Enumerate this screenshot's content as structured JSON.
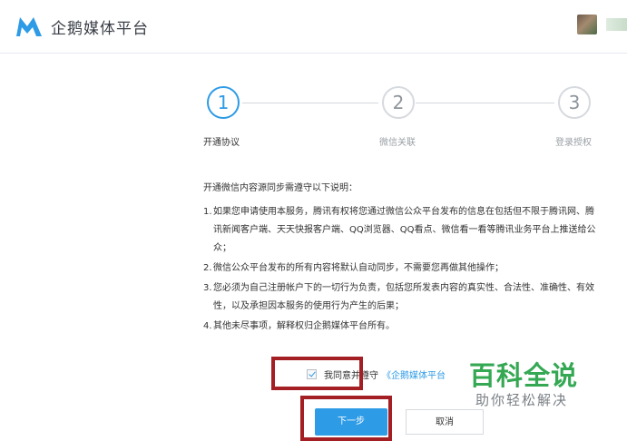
{
  "header": {
    "brand": "企鹅媒体平台",
    "logo_icon": "penguin-media-logo-icon",
    "avatar_icon": "user-avatar-icon"
  },
  "steps": [
    {
      "number": "1",
      "label": "开通协议",
      "active": true
    },
    {
      "number": "2",
      "label": "微信关联",
      "active": false
    },
    {
      "number": "3",
      "label": "登录授权",
      "active": false
    }
  ],
  "agreement": {
    "intro": "开通微信内容源同步需遵守以下说明：",
    "items": [
      {
        "num": "1.",
        "text": "如果您申请使用本服务，腾讯有权将您通过微信公众平台发布的信息在包括但不限于腾讯网、腾讯新闻客户端、天天快报客户端、QQ浏览器、QQ看点、微信看一看等腾讯业务平台上推送给公众；"
      },
      {
        "num": "2.",
        "text": "微信公众平台发布的所有内容将默认自动同步，不需要您再做其他操作；"
      },
      {
        "num": "3.",
        "text": "您必须为自己注册帐户下的一切行为负责，包括您所发表内容的真实性、合法性、准确性、有效性，以及承担因本服务的使用行为产生的后果；"
      },
      {
        "num": "4.",
        "text": "其他未尽事项，解释权归企鹅媒体平台所有。"
      }
    ]
  },
  "agree": {
    "checked": true,
    "text": "我同意并遵守",
    "link": "《企鹅媒体平台"
  },
  "buttons": {
    "next": "下一步",
    "cancel": "取消"
  },
  "watermark": {
    "title": "百科全说",
    "subtitle": "助你轻松解决"
  },
  "colors": {
    "accent": "#2e9be6",
    "highlight": "#a31f24",
    "watermark": "#35a853"
  }
}
